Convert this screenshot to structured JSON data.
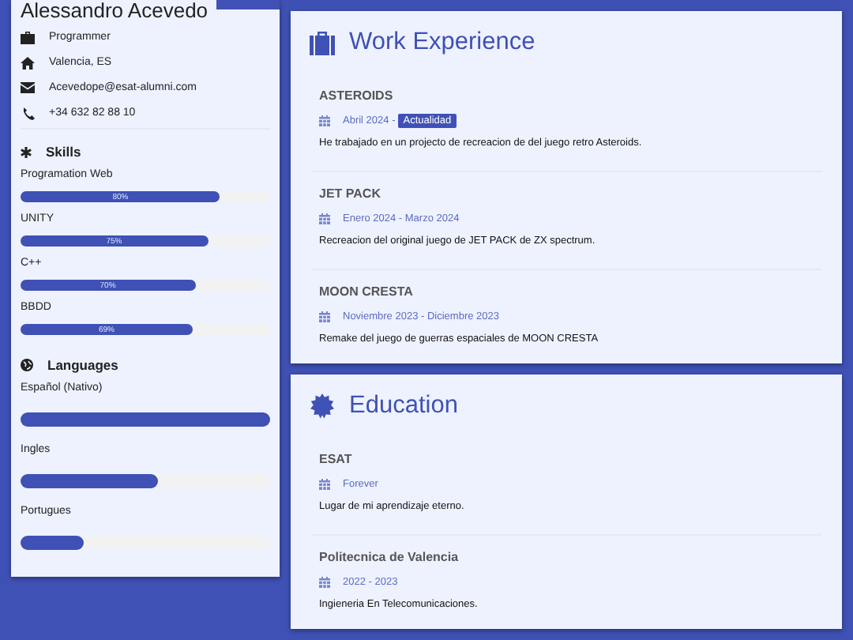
{
  "profile": {
    "name": "Alessandro Acevedo",
    "contacts": [
      {
        "kind": "job",
        "text": "Programmer"
      },
      {
        "kind": "home",
        "text": "Valencia, ES"
      },
      {
        "kind": "email",
        "text": "Acevedope@esat-alumni.com"
      },
      {
        "kind": "phone",
        "text": "+34 632 82 88 10"
      }
    ]
  },
  "skills": {
    "title": "Skills",
    "items": [
      {
        "name": "Programation Web",
        "level": 0.8,
        "reading": "80%"
      },
      {
        "name": "UNITY",
        "level": 0.75,
        "reading": "75%"
      },
      {
        "name": "C++",
        "level": 0.7,
        "reading": "70%"
      },
      {
        "name": "BBDD",
        "level": 0.69,
        "reading": "69%"
      }
    ]
  },
  "languages": {
    "title": "Languages",
    "items": [
      {
        "name": "Español (Nativo)",
        "level": 1.0
      },
      {
        "name": "Ingles",
        "level": 0.55
      },
      {
        "name": "Portugues",
        "level": 0.25
      }
    ]
  },
  "sections": [
    {
      "kind": "work",
      "title": "Work Experience",
      "entries": [
        {
          "title": "ASTEROIDS",
          "date": "Abril 2024 -",
          "badge": "Actualidad",
          "description": "He trabajado en un projecto de recreacion de del juego retro Asteroids."
        },
        {
          "title": "JET PACK",
          "date": "Enero 2024 - Marzo 2024",
          "description": "Recreacion del original juego de JET PACK de ZX spectrum."
        },
        {
          "title": "MOON CRESTA",
          "date": "Noviembre 2023 - Diciembre 2023",
          "description": "Remake del juego de guerras espaciales de MOON CRESTA"
        }
      ]
    },
    {
      "kind": "education",
      "title": "Education",
      "entries": [
        {
          "title": "ESAT",
          "date": "Forever",
          "description": "Lugar de mi aprendizaje eterno."
        },
        {
          "title": "Politecnica de Valencia",
          "date": "2022 - 2023",
          "description": "Ingieneria En Telecomunicaciones."
        }
      ]
    }
  ]
}
